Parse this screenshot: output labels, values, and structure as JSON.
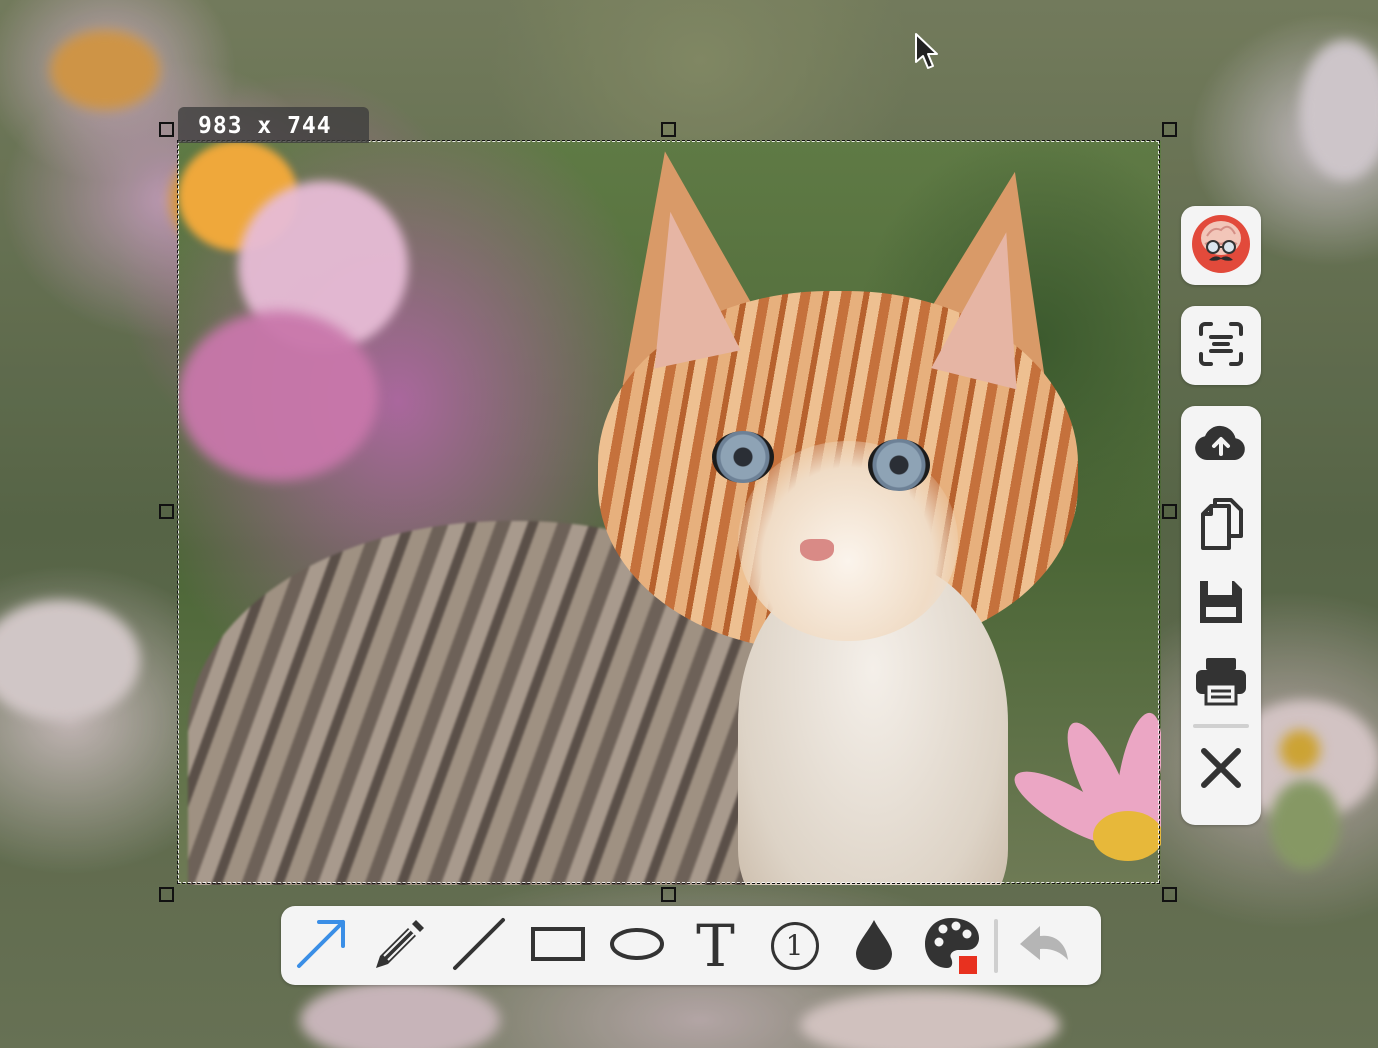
{
  "selection": {
    "size_label": "983 x 744"
  },
  "side_toolbar": {
    "items": [
      {
        "name": "avatar",
        "icon": "brain-mustache-avatar-icon"
      },
      {
        "name": "ocr",
        "icon": "text-scan-icon"
      },
      {
        "name": "upload",
        "icon": "cloud-upload-icon"
      },
      {
        "name": "copy",
        "icon": "copy-icon"
      },
      {
        "name": "save",
        "icon": "floppy-disk-icon"
      },
      {
        "name": "print",
        "icon": "printer-icon"
      },
      {
        "name": "close",
        "icon": "close-icon"
      }
    ]
  },
  "bottom_toolbar": {
    "tools": [
      {
        "name": "arrow",
        "icon": "arrow-icon",
        "active": true
      },
      {
        "name": "pencil",
        "icon": "pencil-icon"
      },
      {
        "name": "line",
        "icon": "line-icon"
      },
      {
        "name": "rectangle",
        "icon": "rectangle-icon"
      },
      {
        "name": "ellipse",
        "icon": "ellipse-icon"
      },
      {
        "name": "text",
        "icon": "text-tool-icon"
      },
      {
        "name": "counter",
        "icon": "number-marker-icon"
      },
      {
        "name": "blur",
        "icon": "drop-icon"
      },
      {
        "name": "color",
        "icon": "palette-icon"
      },
      {
        "name": "undo",
        "icon": "undo-icon"
      }
    ],
    "counter_value": "1",
    "text_tool_glyph": "T"
  },
  "colors": {
    "active_tool": "#3a8ee6",
    "icon": "#333333",
    "disabled_icon": "#b5b5b5",
    "selected_color": "#e8311f"
  }
}
